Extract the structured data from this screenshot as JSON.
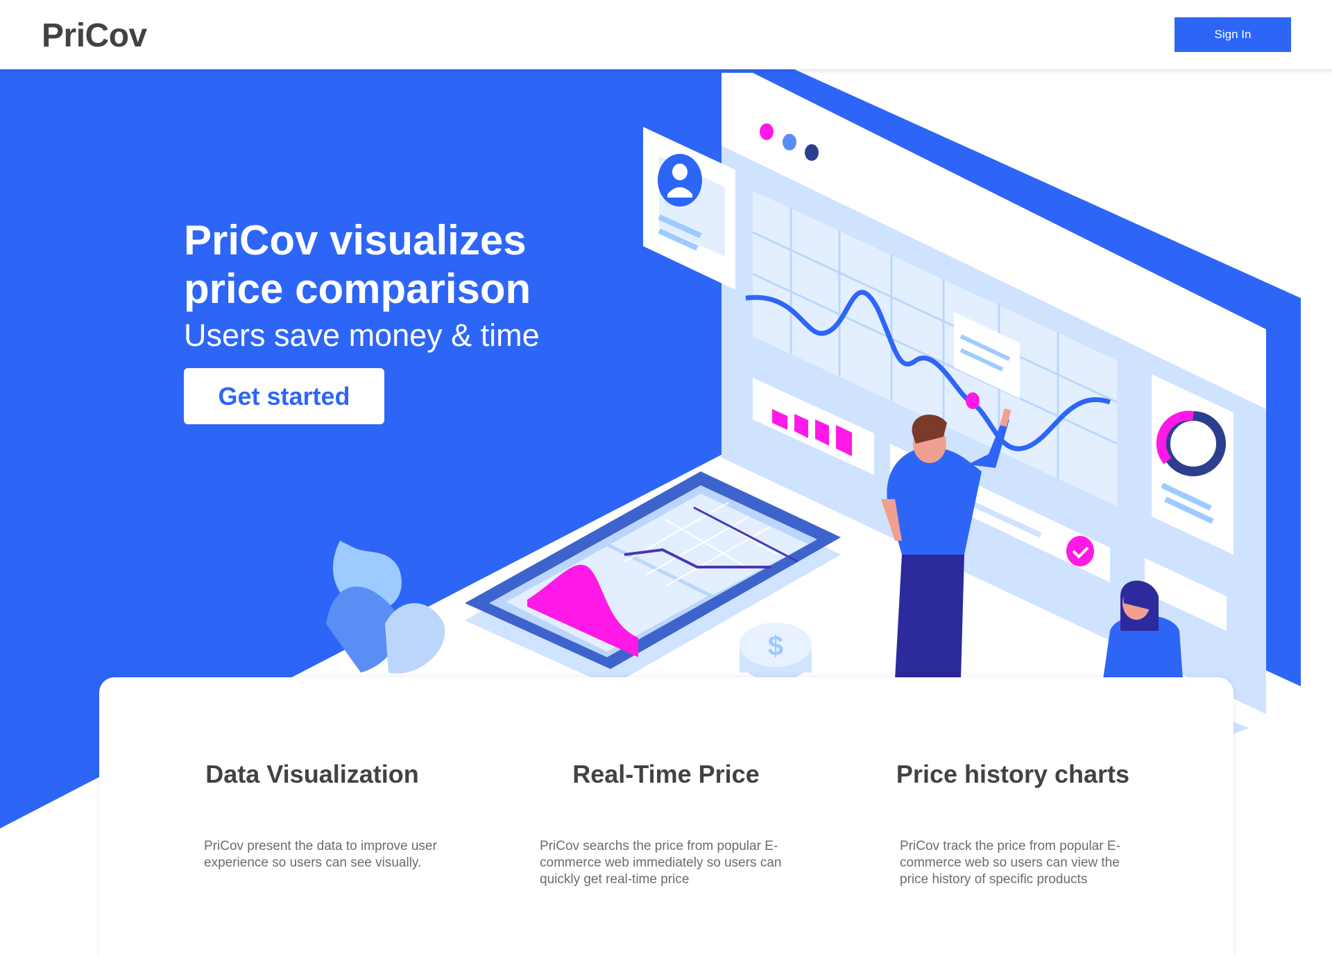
{
  "header": {
    "brand": "PriCov",
    "signin_label": "Sign In"
  },
  "hero": {
    "title": "PriCov visualizes price comparison",
    "subtitle": "Users save money & time",
    "cta_label": "Get started"
  },
  "features": [
    {
      "title": "Data Visualization",
      "description": "PriCov present the data to improve user experience so users can see visually."
    },
    {
      "title": "Real-Time Price",
      "description": "PriCov searchs the price from popular E-commerce web immediately so users can quickly get real-time price"
    },
    {
      "title": "Price history charts",
      "description": "PriCov track the price from popular E-commerce web so users can view the price history of specific products"
    }
  ],
  "colors": {
    "primary": "#2d66f7",
    "accent": "#ff19e6",
    "light_blue": "#9ecbff",
    "navy": "#2c2a9c",
    "text_dark": "#424242",
    "text_muted": "#6b6b6b"
  },
  "icons": [
    "user-icon",
    "dollar-icon",
    "check-icon"
  ]
}
